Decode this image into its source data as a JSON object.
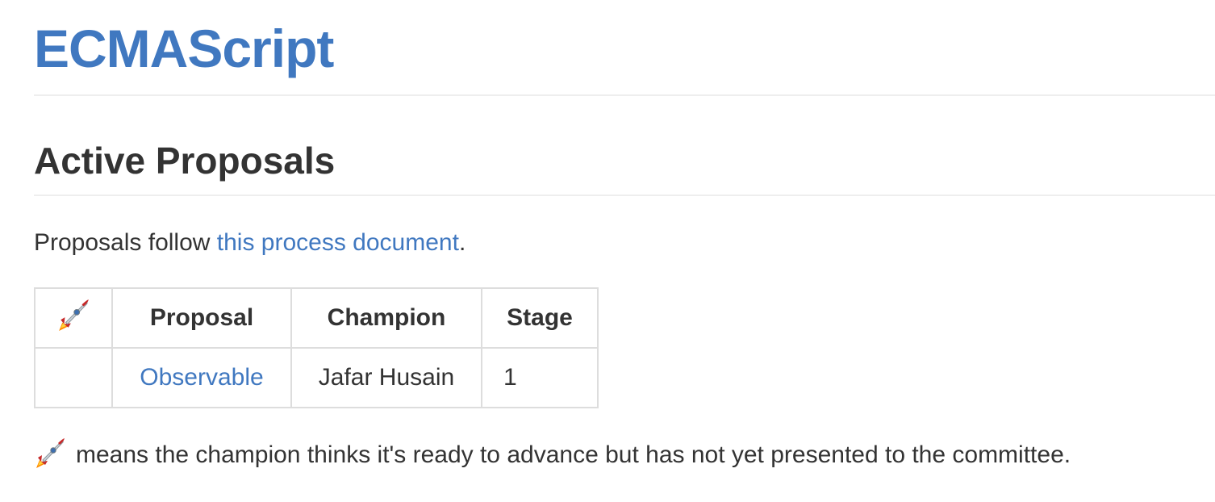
{
  "header": {
    "title": "ECMAScript"
  },
  "section": {
    "heading": "Active Proposals",
    "intro_prefix": "Proposals follow ",
    "intro_link": "this process document",
    "intro_suffix": "."
  },
  "table": {
    "header_icon": "rocket-icon",
    "columns": [
      "Proposal",
      "Champion",
      "Stage"
    ],
    "rows": [
      {
        "icon": "",
        "proposal": "Observable",
        "champion": "Jafar Husain",
        "stage": "1"
      }
    ]
  },
  "legend": {
    "icon": "rocket-icon",
    "text": "means the champion thinks it's ready to advance but has not yet presented to the committee."
  },
  "colors": {
    "link": "#4078c0",
    "text": "#333333",
    "border": "#dddddd",
    "rule": "#eeeeee"
  }
}
